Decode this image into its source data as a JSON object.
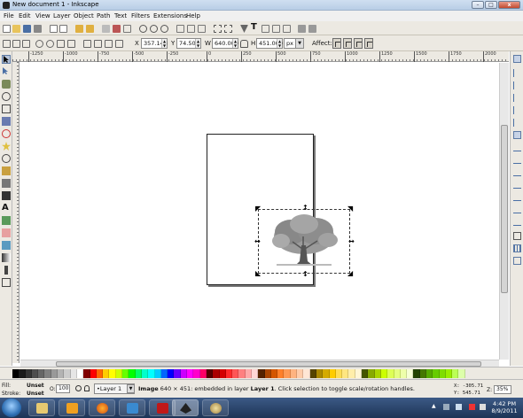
{
  "window": {
    "title": "New document 1 - Inkscape",
    "min_label": "–",
    "max_label": "□",
    "close_label": "x"
  },
  "menu": [
    "File",
    "Edit",
    "View",
    "Layer",
    "Object",
    "Path",
    "Text",
    "Filters",
    "Extensions",
    "Help"
  ],
  "select_toolbar": {
    "x_label": "X",
    "x_value": "357.143",
    "y_label": "Y",
    "y_value": "74.500",
    "w_label": "W",
    "w_value": "640.000",
    "h_label": "H",
    "h_value": "451.000",
    "unit": "px",
    "affect_label": "Affect:"
  },
  "ruler": {
    "h_ticks": [
      "-1250",
      "-1000",
      "-750",
      "-500",
      "-250",
      "0",
      "250",
      "500",
      "750",
      "1000",
      "1250",
      "1500",
      "1750",
      "2000"
    ]
  },
  "canvas": {
    "selected_object": "tree bitmap image"
  },
  "palette": {
    "colors": [
      "#000000",
      "#1a1a1a",
      "#333333",
      "#4d4d4d",
      "#666666",
      "#808080",
      "#999999",
      "#b3b3b3",
      "#cccccc",
      "#e6e6e6",
      "#ffffff",
      "#800000",
      "#ff0000",
      "#ff6600",
      "#ffcc00",
      "#ffff00",
      "#ccff00",
      "#66ff00",
      "#00ff00",
      "#00ff66",
      "#00ffcc",
      "#00ffff",
      "#00ccff",
      "#0066ff",
      "#0000ff",
      "#6600ff",
      "#cc00ff",
      "#ff00ff",
      "#ff00cc",
      "#ff0066",
      "#550000",
      "#aa0000",
      "#d40000",
      "#ff2a2a",
      "#ff5555",
      "#ff8080",
      "#ffaaaa",
      "#ffd5d5",
      "#552200",
      "#aa4400",
      "#d45500",
      "#ff7f2a",
      "#ff9955",
      "#ffb380",
      "#ffccaa",
      "#ffe6d5",
      "#554400",
      "#aa8800",
      "#d4aa00",
      "#ffcc00",
      "#ffdd55",
      "#ffe680",
      "#ffeeaa",
      "#fff6d5",
      "#445500",
      "#88aa00",
      "#aad400",
      "#ccff00",
      "#ddff55",
      "#e5ff80",
      "#eeffaa",
      "#f6ffd5",
      "#224400",
      "#447700",
      "#55aa00",
      "#66cc00",
      "#7fdd00",
      "#99ee00",
      "#bbff55",
      "#ddffaa"
    ]
  },
  "status": {
    "fill_label": "Fill:",
    "fill_value": "Unset",
    "stroke_label": "Stroke:",
    "stroke_value": "Unset",
    "opacity_label": "O:",
    "opacity_value": "100",
    "layer_name": "•Layer 1",
    "message_bold": "Image",
    "message": " 640 × 451: embedded in layer ",
    "message_layer": "Layer 1",
    "message_tail": ". Click selection to toggle scale/rotation handles.",
    "cursor_x": "X: -305.71",
    "cursor_y": "Y:  545.71",
    "zoom_label": "Z:",
    "zoom_value": "35%"
  },
  "taskbar": {
    "time": "4:42 PM",
    "date": "8/9/2011"
  }
}
